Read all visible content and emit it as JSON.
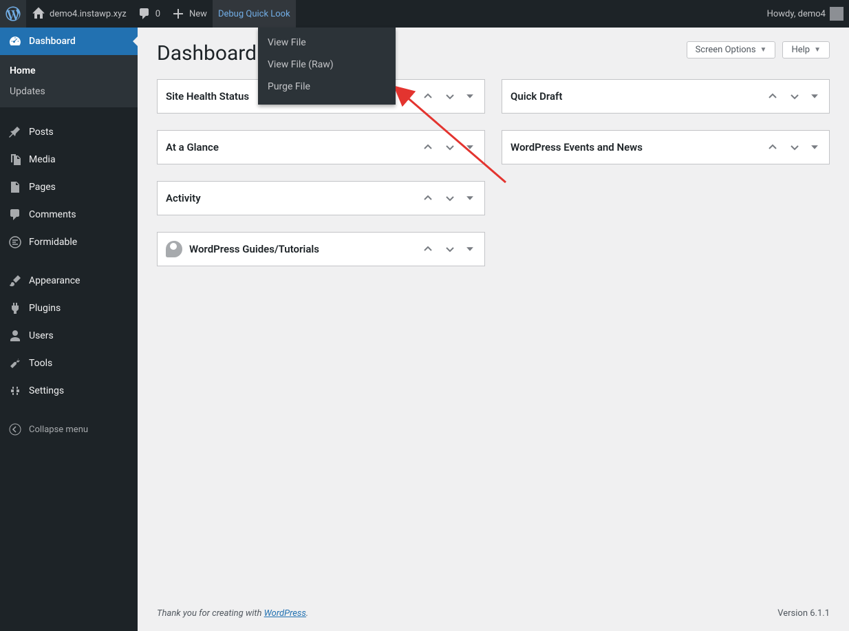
{
  "adminbar": {
    "site_name": "demo4.instawp.xyz",
    "comments_count": "0",
    "new_label": "New",
    "debug_label": "Debug Quick Look",
    "howdy_prefix": "Howdy, ",
    "user_name": "demo4"
  },
  "dropdown": {
    "items": [
      "View File",
      "View File (Raw)",
      "Purge File"
    ]
  },
  "sidebar": {
    "dashboard_label": "Dashboard",
    "submenu": {
      "home": "Home",
      "updates": "Updates"
    },
    "items": [
      "Posts",
      "Media",
      "Pages",
      "Comments",
      "Formidable"
    ],
    "items2": [
      "Appearance",
      "Plugins",
      "Users",
      "Tools",
      "Settings"
    ],
    "collapse_label": "Collapse menu"
  },
  "page": {
    "title": "Dashboard",
    "screen_options": "Screen Options",
    "help": "Help"
  },
  "widgets_left": [
    "Site Health Status",
    "At a Glance",
    "Activity",
    "WordPress Guides/Tutorials"
  ],
  "widgets_right": [
    "Quick Draft",
    "WordPress Events and News"
  ],
  "footer": {
    "thanks_prefix": "Thank you for creating with ",
    "wordpress_link": "WordPress",
    "thanks_suffix": ".",
    "version": "Version 6.1.1"
  }
}
